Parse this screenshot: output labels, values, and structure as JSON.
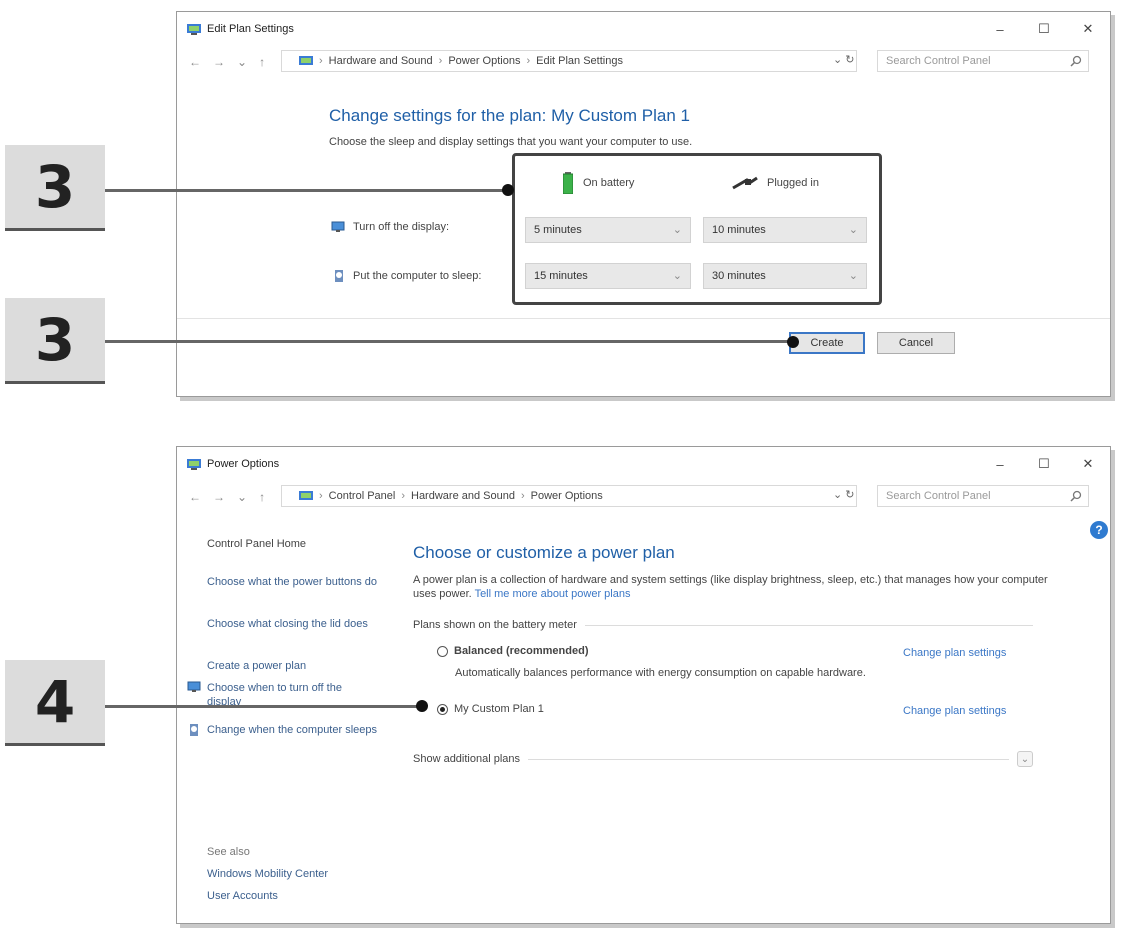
{
  "colors": {
    "accent": "#1f5fa7",
    "link": "#3b77c6",
    "callout_line": "#666666",
    "badge_bg": "#dcdcdc"
  },
  "window_edit_plan": {
    "title": "Edit Plan Settings",
    "breadcrumb": [
      "Hardware and Sound",
      "Power Options",
      "Edit Plan Settings"
    ],
    "search_placeholder": "Search Control Panel",
    "heading": "Change settings for the plan: My Custom Plan 1",
    "subheading": "Choose the sleep and display settings that you want your computer to use.",
    "col_battery": "On battery",
    "col_plugged": "Plugged in",
    "row_display_label": "Turn off the display:",
    "row_sleep_label": "Put the computer to sleep:",
    "display_battery": "5 minutes",
    "display_plugged": "10 minutes",
    "sleep_battery": "15 minutes",
    "sleep_plugged": "30 minutes",
    "create_label": "Create",
    "cancel_label": "Cancel"
  },
  "window_power_options": {
    "title": "Power Options",
    "breadcrumb": [
      "Control Panel",
      "Hardware and Sound",
      "Power Options"
    ],
    "search_placeholder": "Search Control Panel",
    "sidebar": {
      "home": "Control Panel Home",
      "items": [
        "Choose what the power buttons do",
        "Choose what closing the lid does",
        "Create a power plan",
        "Choose when to turn off the display",
        "Change when the computer sleeps"
      ],
      "see_also_title": "See also",
      "see_also": [
        "Windows Mobility Center",
        "User Accounts"
      ]
    },
    "heading": "Choose or customize a power plan",
    "description": "A power plan is a collection of hardware and system settings (like display brightness, sleep, etc.) that manages how your computer uses power.",
    "description_link": "Tell me more about power plans",
    "section_label": "Plans shown on the battery meter",
    "plan1_name": "Balanced (recommended)",
    "plan1_desc": "Automatically balances performance with energy consumption on capable hardware.",
    "plan1_link": "Change plan settings",
    "plan2_name": "My Custom Plan 1",
    "plan2_link": "Change plan settings",
    "additional_label": "Show additional plans"
  },
  "callouts": {
    "step_a": "3",
    "step_b": "3",
    "step_c": "4"
  }
}
